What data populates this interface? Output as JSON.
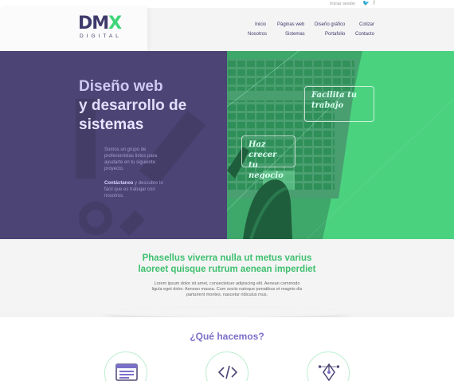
{
  "topbar": {
    "login_label": "Iniciar sesión"
  },
  "social": {
    "icons": [
      "twitter-icon",
      "facebook-icon"
    ],
    "twitter_glyph": "🐦",
    "facebook_glyph": "f"
  },
  "logo": {
    "main_left": "DM",
    "main_x": "X",
    "sub": "DIGITAL"
  },
  "nav": {
    "items": [
      {
        "label": "Inicio"
      },
      {
        "label": "Páginas web"
      },
      {
        "label": "Diseño gráfico"
      },
      {
        "label": "Cotizar"
      },
      {
        "label": "Nosotros"
      },
      {
        "label": "Sistemas"
      },
      {
        "label": "Portafolio"
      },
      {
        "label": "Contacto"
      }
    ]
  },
  "hero": {
    "title_1": "Diseño web",
    "title_2": "y desarrollo de",
    "title_3": "sistemas",
    "text": "Somos un grupo de profesionistas listos para ayudarte en tu siguiente proyecto.",
    "cta_bold": "Contáctanos",
    "cta_rest": " y descubre lo fácil que es trabajar con nosotros.",
    "bubble_1": "Facilita tu trabajo",
    "bubble_2": "Haz crecer tu negocio"
  },
  "intro": {
    "title_line_1": "Phasellus viverra nulla ut metus varius",
    "title_line_2": "laoreet quisque rutrum aenean imperdiet",
    "text": "Lorem ipsum dolor sit amet, consectetuer adipiscing elit. Aenean commodo ligula eget dolor. Aenean massa. Cum sociis natoque penatibus et magnis dis parturient montes, nascetur ridiculus mus."
  },
  "services": {
    "title": "¿Qué hacemos?",
    "items": [
      {
        "icon": "browser-window-icon"
      },
      {
        "icon": "code-icon"
      },
      {
        "icon": "pen-tool-icon"
      }
    ]
  },
  "colors": {
    "brand_purple": "#4b4474",
    "brand_green": "#4bd27f",
    "accent_lavender": "#7a6fc9"
  }
}
